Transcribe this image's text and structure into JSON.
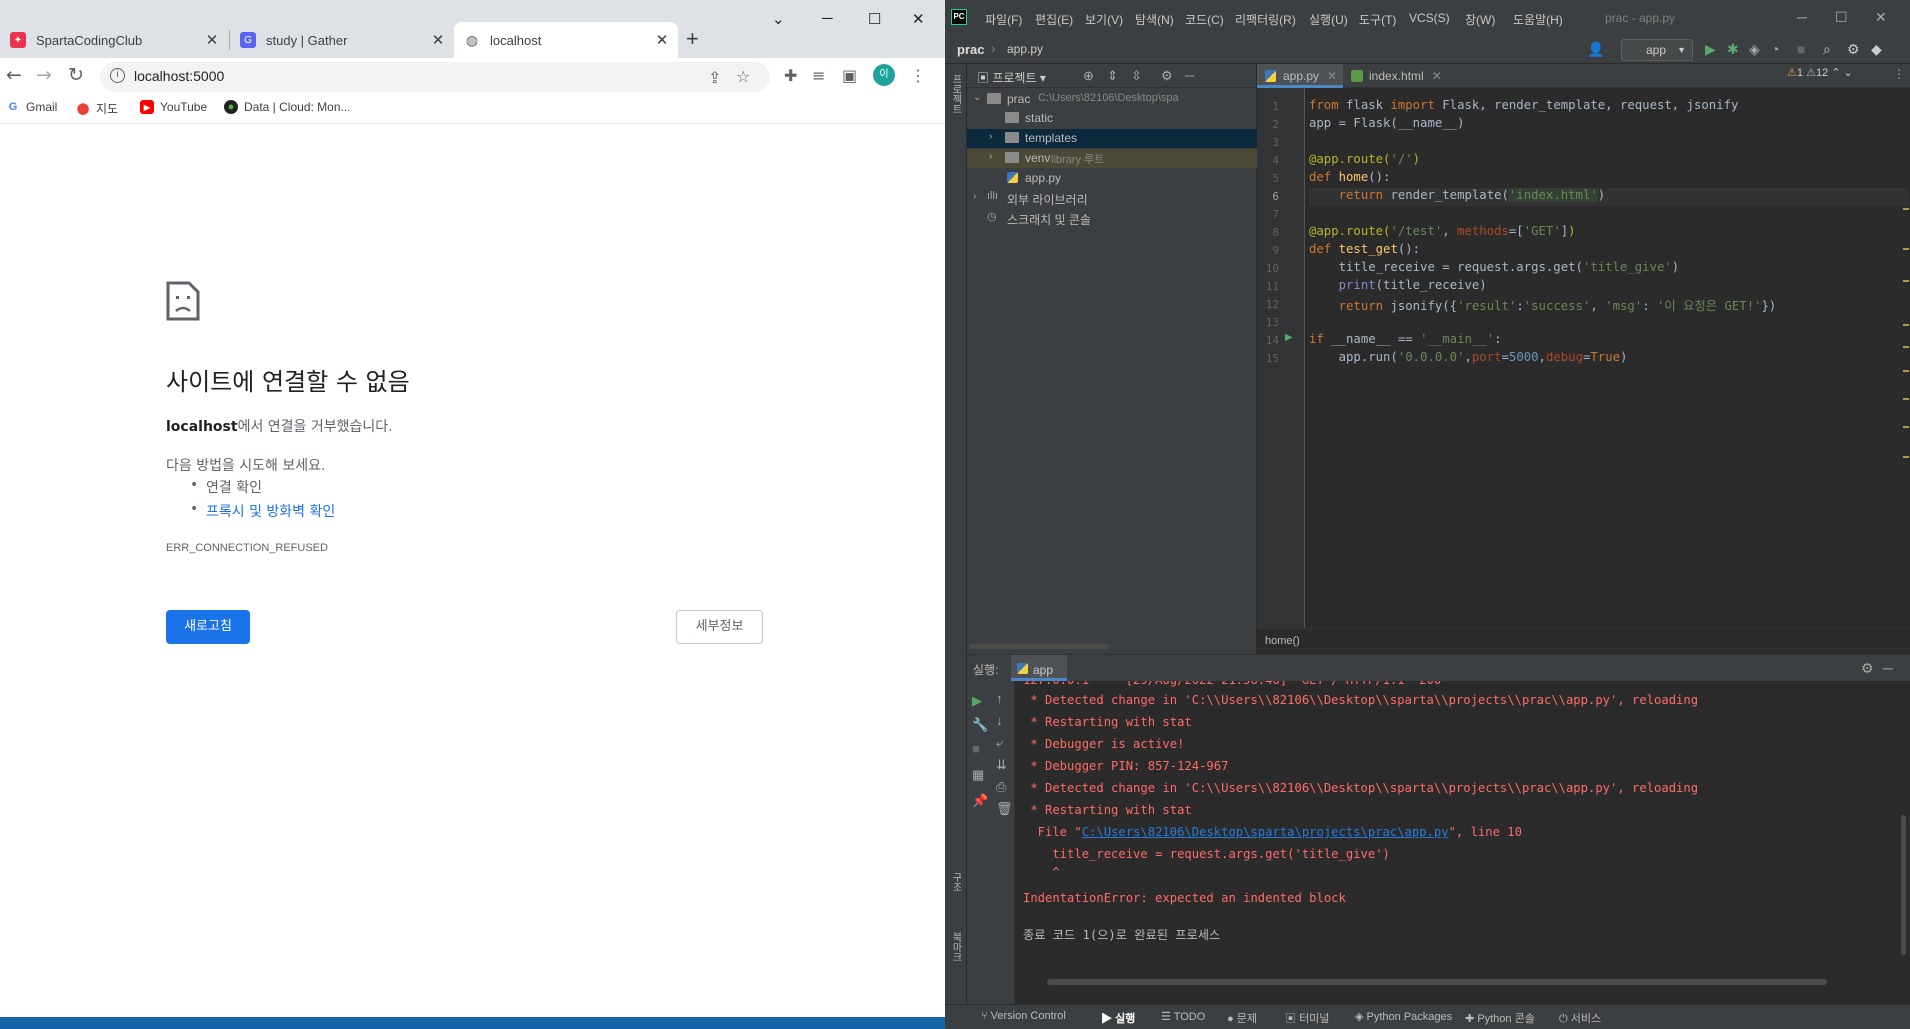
{
  "chrome": {
    "tabs": [
      {
        "title": "SpartaCodingClub",
        "favicon_color": "#e8344e"
      },
      {
        "title": "study | Gather",
        "favicon_color": "#5865f2"
      },
      {
        "title": "localhost",
        "favicon_color": "#5f6368"
      }
    ],
    "url": "localhost:5000",
    "bookmarks": [
      {
        "label": "Gmail"
      },
      {
        "label": "지도"
      },
      {
        "label": "YouTube"
      },
      {
        "label": "Data | Cloud: Mon..."
      }
    ],
    "profile_initial": "이",
    "error": {
      "title": "사이트에 연결할 수 없음",
      "host": "localhost",
      "message_suffix": "에서 연결을 거부했습니다.",
      "try_heading": "다음 방법을 시도해 보세요.",
      "suggestions": [
        "연결 확인",
        "프록시 및 방화벽 확인"
      ],
      "code": "ERR_CONNECTION_REFUSED",
      "reload_label": "새로고침",
      "details_label": "세부정보"
    }
  },
  "ide": {
    "menus": [
      "파일(F)",
      "편집(E)",
      "보기(V)",
      "탐색(N)",
      "코드(C)",
      "리팩터링(R)",
      "실행(U)",
      "도구(T)",
      "VCS(S)",
      "창(W)",
      "도움말(H)"
    ],
    "window_title": "prac - app.py",
    "breadcrumb": {
      "project": "prac",
      "file": "app.py"
    },
    "run_config": "app",
    "project_panel": {
      "title": "프로젝트",
      "root_name": "prac",
      "root_path": "C:\\Users\\82106\\Desktop\\spa",
      "items": [
        {
          "label": "static"
        },
        {
          "label": "templates"
        },
        {
          "label": "venv",
          "note": "library 루트"
        },
        {
          "label": "app.py"
        },
        {
          "label": "외부 라이브러리"
        },
        {
          "label": "스크래치 및 콘솔"
        }
      ]
    },
    "side_tabs": [
      "프로젝트",
      "구조",
      "북마크"
    ],
    "editor_tabs": [
      {
        "label": "app.py"
      },
      {
        "label": "index.html"
      }
    ],
    "inspections": {
      "warnings": "1",
      "weak_warnings": "12"
    },
    "code_lines": [
      "1",
      "2",
      "3",
      "4",
      "5",
      "6",
      "7",
      "8",
      "9",
      "10",
      "11",
      "12",
      "13",
      "14",
      "15"
    ],
    "code_crumb": "home()",
    "run_panel": {
      "label": "실행:",
      "tab": "app",
      "console": [
        "127.0.0.1 - - [29/Aug/2022 21:56:46] \"GET / HTTP/1.1\" 200 -",
        " * Detected change in 'C:\\\\Users\\\\82106\\\\Desktop\\\\sparta\\\\projects\\\\prac\\\\app.py', reloading",
        " * Restarting with stat",
        " * Debugger is active!",
        " * Debugger PIN: 857-124-967",
        " * Detected change in 'C:\\\\Users\\\\82106\\\\Desktop\\\\sparta\\\\projects\\\\prac\\\\app.py', reloading",
        " * Restarting with stat"
      ],
      "trace_file_prefix": "  File \"",
      "trace_file_link": "C:\\Users\\82106\\Desktop\\sparta\\projects\\prac\\app.py",
      "trace_file_suffix": "\", line 10",
      "trace_code": "    title_receive = request.args.get('title_give')",
      "trace_caret": "    ^",
      "error_line": "IndentationError: expected an indented block",
      "exit_line": "종료 코드 1(으)로 완료된 프로세스"
    },
    "toolwindows": [
      "Version Control",
      "실행",
      "TODO",
      "문제",
      "터미널",
      "Python Packages",
      "Python 콘솔",
      "서비스"
    ]
  },
  "colors": {
    "chrome_tabstrip": "#dee1e6",
    "link_blue": "#1a73e8",
    "ide_bg": "#3c3f41",
    "editor_bg": "#2b2b2b",
    "console_error": "#ff6b68"
  }
}
